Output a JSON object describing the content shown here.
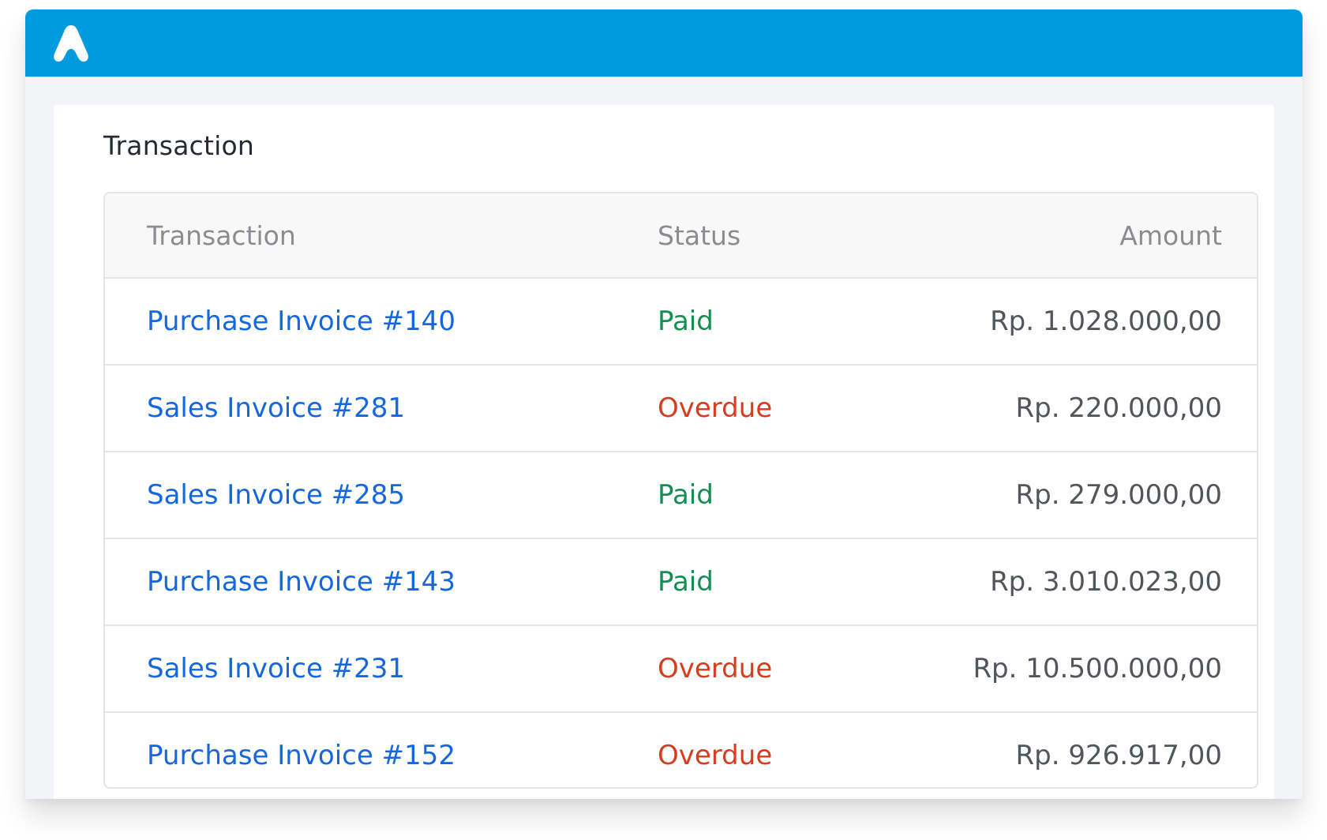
{
  "header": {
    "logo_icon": "app-logo-icon",
    "bar_color": "#009bdf"
  },
  "card": {
    "title": "Transaction"
  },
  "table": {
    "columns": {
      "transaction": "Transaction",
      "status": "Status",
      "amount": "Amount"
    },
    "rows": [
      {
        "transaction": "Purchase Invoice #140",
        "status": "Paid",
        "amount": "Rp. 1.028.000,00"
      },
      {
        "transaction": "Sales Invoice #281",
        "status": "Overdue",
        "amount": "Rp. 220.000,00"
      },
      {
        "transaction": "Sales Invoice #285",
        "status": "Paid",
        "amount": "Rp. 279.000,00"
      },
      {
        "transaction": "Purchase Invoice #143",
        "status": "Paid",
        "amount": "Rp. 3.010.023,00"
      },
      {
        "transaction": "Sales Invoice #231",
        "status": "Overdue",
        "amount": "Rp. 10.500.000,00"
      },
      {
        "transaction": "Purchase Invoice #152",
        "status": "Overdue",
        "amount": "Rp. 926.917,00"
      }
    ]
  },
  "colors": {
    "link": "#1567e0",
    "paid": "#138f52",
    "overdue": "#d63d1f"
  }
}
